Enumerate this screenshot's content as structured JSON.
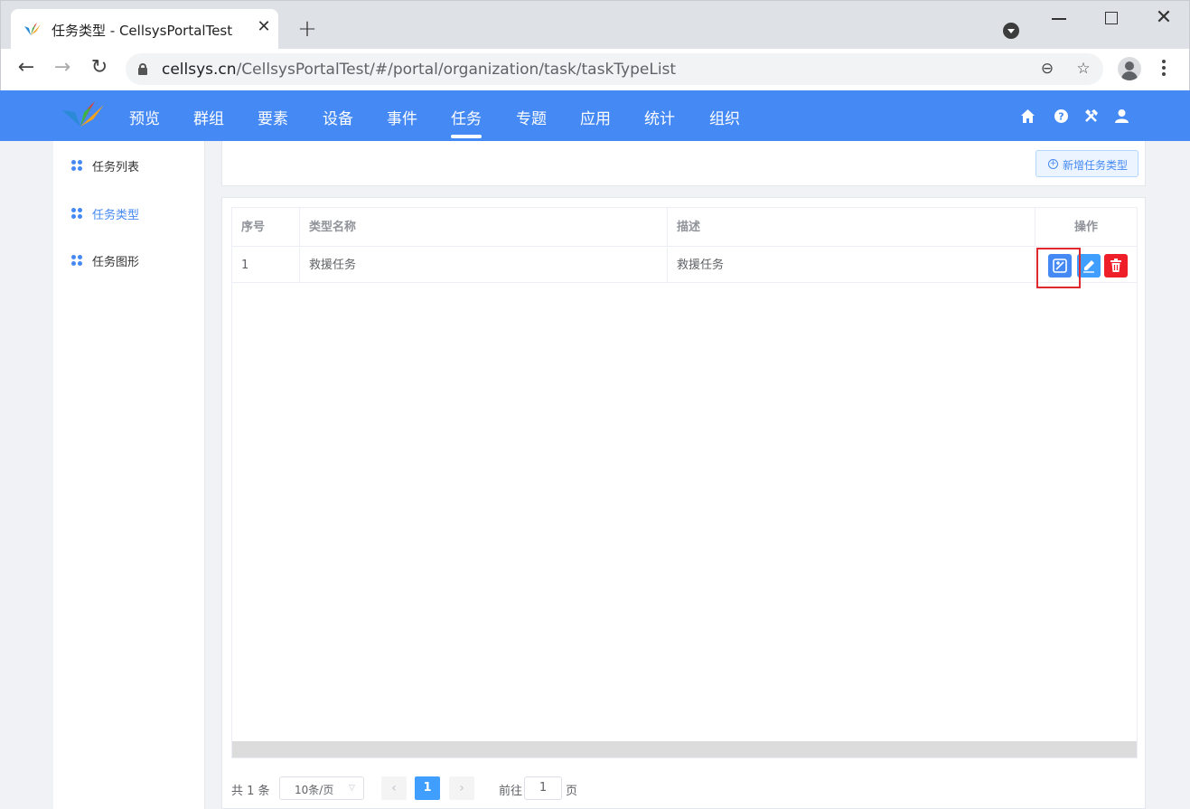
{
  "browser": {
    "tab_title": "任务类型 - CellsysPortalTest",
    "tab_close": "✕",
    "new_tab": "+",
    "url_host": "cellsys.cn",
    "url_path": "/CellsysPortalTest/#/portal/organization/task/taskTypeList"
  },
  "header": {
    "menu": [
      "预览",
      "群组",
      "要素",
      "设备",
      "事件",
      "任务",
      "专题",
      "应用",
      "统计",
      "组织"
    ],
    "active_menu": "任务",
    "icons": [
      "home-icon",
      "help-icon",
      "tools-icon",
      "user-icon"
    ]
  },
  "sidebar": {
    "items": [
      {
        "label": "任务列表",
        "active": false
      },
      {
        "label": "任务类型",
        "active": true
      },
      {
        "label": "任务图形",
        "active": false
      }
    ]
  },
  "toolbar": {
    "add_label": "新增任务类型"
  },
  "table": {
    "columns": [
      "序号",
      "类型名称",
      "描述",
      "操作"
    ],
    "rows": [
      {
        "index": "1",
        "name": "救援任务",
        "desc": "救援任务",
        "actions": [
          "graphic-icon",
          "edit-icon",
          "delete-icon"
        ]
      }
    ]
  },
  "pagination": {
    "total": "共 1 条",
    "page_size": "10条/页",
    "current_page": "1",
    "goto_label": "前往",
    "goto_value": "1",
    "page_suffix": "页"
  },
  "colors": {
    "brand": "#4589f4",
    "danger": "#ee1f29",
    "highlight": "#e0282e"
  }
}
